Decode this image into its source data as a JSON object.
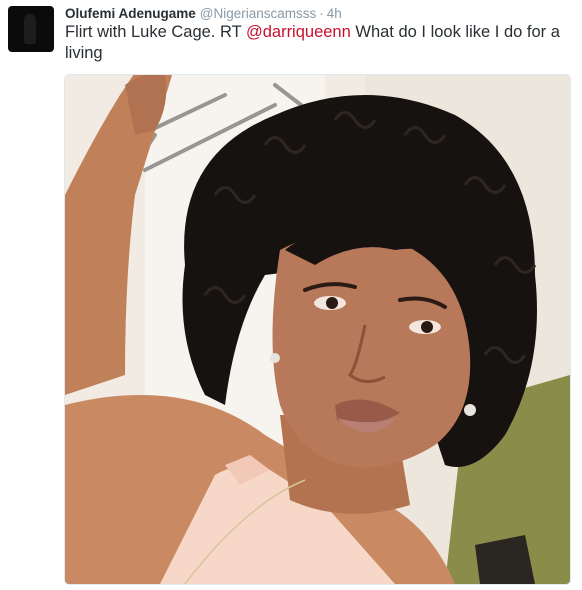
{
  "tweet": {
    "author_name": "Olufemi Adenugame",
    "handle": "@Nigerianscamsss",
    "separator": "·",
    "time": "4h",
    "text_before": "Flirt with Luke Cage. RT ",
    "mention": "@darriqueenn",
    "text_after": " What do I look like I do for a living"
  },
  "colors": {
    "text": "#292f33",
    "meta": "#8899a6",
    "mention": "#c8102e",
    "photo_border": "#e1e8ed"
  },
  "icons": {
    "avatar": "profile-photo"
  }
}
